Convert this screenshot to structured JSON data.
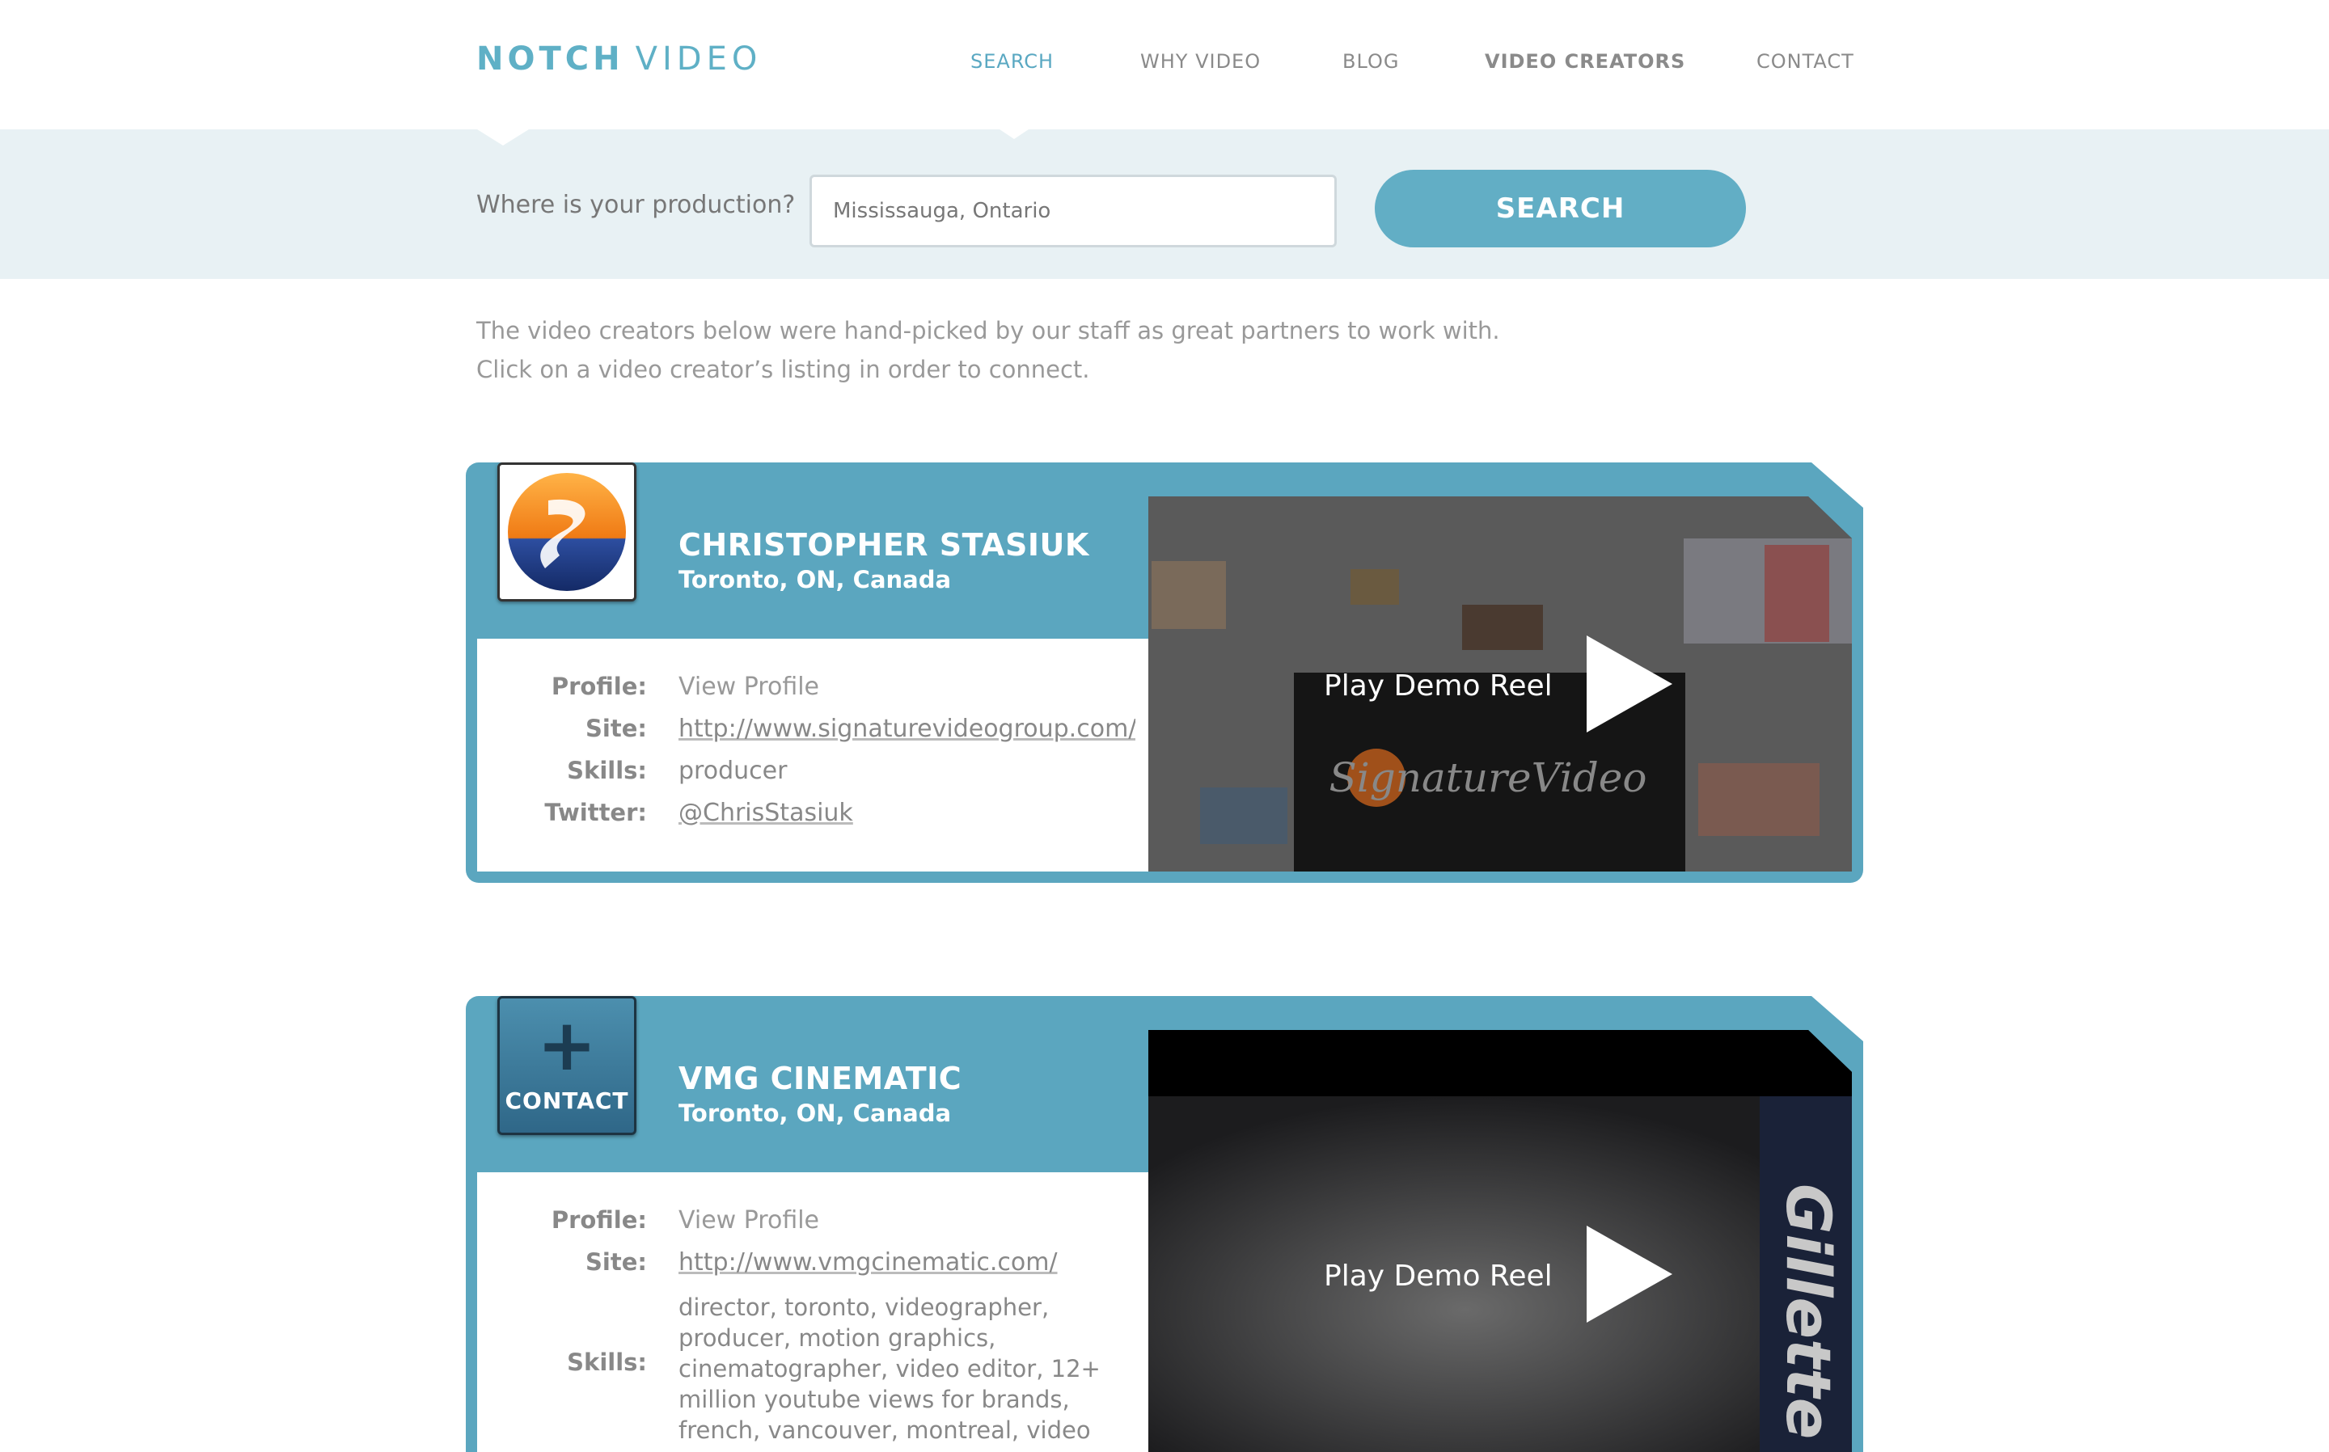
{
  "header": {
    "logo_bold": "NOTCH",
    "logo_light": "VIDEO",
    "nav": [
      {
        "label": "SEARCH"
      },
      {
        "label": "WHY VIDEO"
      },
      {
        "label": "BLOG"
      },
      {
        "label": "VIDEO CREATORS"
      },
      {
        "label": "CONTACT"
      }
    ]
  },
  "search": {
    "label": "Where is your production?",
    "value": "Mississauga, Ontario",
    "button_label": "SEARCH"
  },
  "intro": {
    "line1": "The video creators below were hand-picked by our staff as great partners to work with.",
    "line2": "Click on a video creator’s listing in order to connect."
  },
  "creators": [
    {
      "name": "CHRISTOPHER STASIUK",
      "location": "Toronto, ON, Canada",
      "labels": {
        "profile": "Profile:",
        "site": "Site:",
        "skills": "Skills:",
        "twitter": "Twitter:"
      },
      "profile": "View Profile",
      "site": "http://www.signaturevideogroup.com/",
      "skills": "producer",
      "twitter": "@ChrisStasiuk",
      "demo_label": "Play Demo Reel",
      "thumb_text": "SignatureVideo"
    },
    {
      "name": "VMG CINEMATIC",
      "location": "Toronto, ON, Canada",
      "contact_label": "CONTACT",
      "labels": {
        "profile": "Profile:",
        "site": "Site:",
        "skills": "Skills:"
      },
      "profile": "View Profile",
      "site": "http://www.vmgcinematic.com/",
      "skills_lines": [
        "director, toronto, videographer,",
        "producer, motion graphics,",
        "cinematographer, video editor, 12+",
        "million youtube views for brands,",
        "french, vancouver, montreal, video"
      ],
      "demo_label": "Play Demo Reel",
      "thumb_text": "Gillette"
    }
  ],
  "colors": {
    "accent": "#5fb0c6",
    "card": "#5ba6bf",
    "band": "#e8f1f4"
  }
}
